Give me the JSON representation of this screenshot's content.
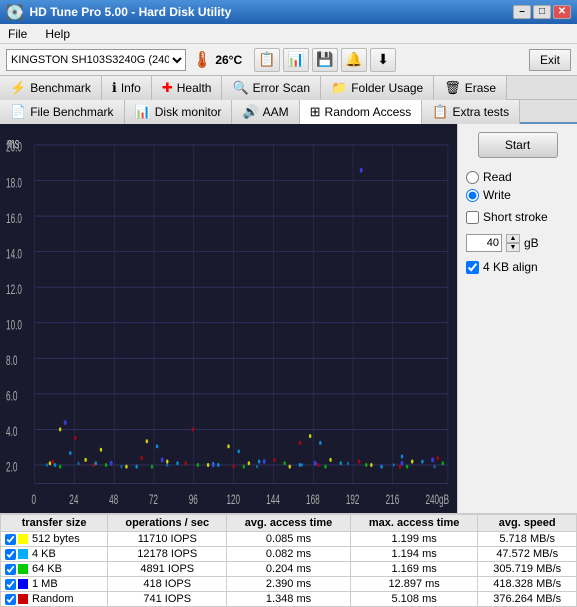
{
  "titleBar": {
    "title": "HD Tune Pro 5.00 - Hard Disk Utility",
    "minimize": "–",
    "maximize": "□",
    "close": "✕"
  },
  "menuBar": {
    "items": [
      "File",
      "Help"
    ]
  },
  "toolbar": {
    "driveLabel": "KINGSTON SH103S3240G (240 GB)",
    "temperature": "26°C",
    "exitLabel": "Exit"
  },
  "tabs1": [
    {
      "label": "Benchmark",
      "icon": "⚡"
    },
    {
      "label": "Info",
      "icon": "ℹ"
    },
    {
      "label": "Health",
      "icon": "➕"
    },
    {
      "label": "Error Scan",
      "icon": "🔍"
    },
    {
      "label": "Folder Usage",
      "icon": "📁"
    },
    {
      "label": "Erase",
      "icon": "🗑"
    }
  ],
  "tabs2": [
    {
      "label": "File Benchmark",
      "icon": "📄"
    },
    {
      "label": "Disk monitor",
      "icon": "📊"
    },
    {
      "label": "AAM",
      "icon": "🔊"
    },
    {
      "label": "Random Access",
      "icon": "⊞",
      "active": true
    },
    {
      "label": "Extra tests",
      "icon": "📋"
    }
  ],
  "chart": {
    "yAxisLabel": "ms",
    "yMax": 20.0,
    "xMax": 240,
    "xUnit": "gB",
    "gridLines": [
      20.0,
      18.0,
      16.0,
      14.0,
      12.0,
      10.0,
      8.0,
      6.0,
      4.0,
      2.0,
      0
    ],
    "xLabels": [
      0,
      24,
      48,
      72,
      96,
      120,
      144,
      168,
      192,
      216,
      240
    ]
  },
  "rightPanel": {
    "startLabel": "Start",
    "readLabel": "Read",
    "writeLabel": "Write",
    "shortStrokeLabel": "Short stroke",
    "shortStrokeValue": "40",
    "gBLabel": "gB",
    "kbAlignLabel": "4 KB align",
    "writeSelected": true,
    "shortStrokeChecked": false,
    "kbAlignChecked": true
  },
  "dataTable": {
    "headers": [
      "transfer size",
      "operations / sec",
      "avg. access time",
      "max. access time",
      "avg. speed"
    ],
    "rows": [
      {
        "color": "#ffff00",
        "label": "512 bytes",
        "ops": "11710 IOPS",
        "avgAccess": "0.085 ms",
        "maxAccess": "1.199 ms",
        "avgSpeed": "5.718 MB/s"
      },
      {
        "color": "#00aaff",
        "label": "4 KB",
        "ops": "12178 IOPS",
        "avgAccess": "0.082 ms",
        "maxAccess": "1.194 ms",
        "avgSpeed": "47.572 MB/s"
      },
      {
        "color": "#00cc00",
        "label": "64 KB",
        "ops": "4891 IOPS",
        "avgAccess": "0.204 ms",
        "maxAccess": "1.169 ms",
        "avgSpeed": "305.719 MB/s"
      },
      {
        "color": "#0000ff",
        "label": "1 MB",
        "ops": "418 IOPS",
        "avgAccess": "2.390 ms",
        "maxAccess": "12.897 ms",
        "avgSpeed": "418.328 MB/s"
      },
      {
        "color": "#cc0000",
        "label": "Random",
        "ops": "741 IOPS",
        "avgAccess": "1.348 ms",
        "maxAccess": "5.108 ms",
        "avgSpeed": "376.264 MB/s"
      }
    ]
  }
}
